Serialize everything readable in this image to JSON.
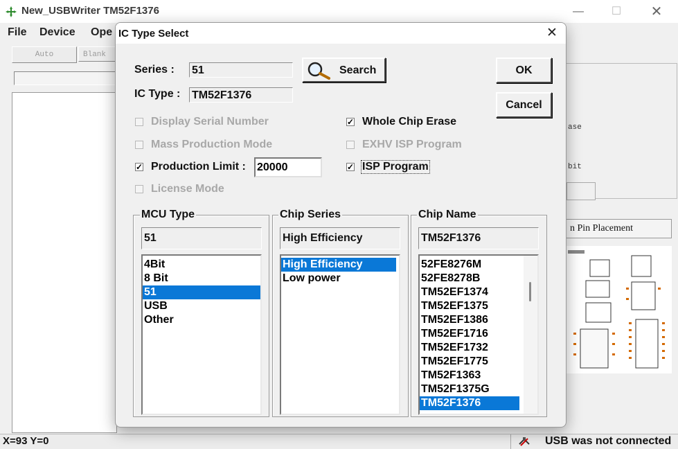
{
  "main": {
    "title": "New_USBWriter  TM52F1376",
    "menu": [
      "File",
      "Device",
      "Ope"
    ],
    "toolbar": {
      "auto": "Auto",
      "blank": "Blank"
    },
    "right_panel": {
      "erase_fragment": "ase",
      "bit_fragment": "bit",
      "pin_placement": "n Pin Placement"
    },
    "status": {
      "coords": "X=93 Y=0",
      "usb": "USB was not connected"
    }
  },
  "dialog": {
    "title": "IC Type Select",
    "series_label": "Series :",
    "series_value": "51",
    "ictype_label": "IC Type :",
    "ictype_value": "TM52F1376",
    "search_label": "Search",
    "ok_label": "OK",
    "cancel_label": "Cancel",
    "options": {
      "display_serial": {
        "label": "Display Serial Number",
        "checked": false,
        "enabled": false
      },
      "mass_production": {
        "label": "Mass Production Mode",
        "checked": false,
        "enabled": false
      },
      "production_limit": {
        "label": "Production Limit :",
        "checked": true,
        "enabled": true,
        "value": "20000"
      },
      "license_mode": {
        "label": "License Mode",
        "checked": false,
        "enabled": false
      },
      "whole_chip_erase": {
        "label": "Whole Chip Erase",
        "checked": true,
        "enabled": true
      },
      "exhv_isp": {
        "label": "EXHV ISP Program",
        "checked": false,
        "enabled": false
      },
      "isp_program": {
        "label": "ISP Program",
        "checked": true,
        "enabled": true
      }
    },
    "mcu_type": {
      "title": "MCU Type",
      "selected": "51",
      "items": [
        {
          "label": "4Bit",
          "selected": false
        },
        {
          "label": "8 Bit",
          "selected": false
        },
        {
          "label": "51",
          "selected": true
        },
        {
          "label": "USB",
          "selected": false
        },
        {
          "label": "Other",
          "selected": false
        }
      ]
    },
    "chip_series": {
      "title": "Chip Series",
      "selected": "High Efficiency",
      "items": [
        {
          "label": "High Efficiency",
          "selected": true
        },
        {
          "label": "Low power",
          "selected": false
        }
      ]
    },
    "chip_name": {
      "title": "Chip Name",
      "selected": "TM52F1376",
      "items": [
        {
          "label": "52FE8276M",
          "selected": false
        },
        {
          "label": "52FE8278B",
          "selected": false
        },
        {
          "label": "TM52EF1374",
          "selected": false
        },
        {
          "label": "TM52EF1375",
          "selected": false
        },
        {
          "label": "TM52EF1386",
          "selected": false
        },
        {
          "label": "TM52EF1716",
          "selected": false
        },
        {
          "label": "TM52EF1732",
          "selected": false
        },
        {
          "label": "TM52EF1775",
          "selected": false
        },
        {
          "label": "TM52F1363",
          "selected": false
        },
        {
          "label": "TM52F1375G",
          "selected": false
        },
        {
          "label": "TM52F1376",
          "selected": true
        }
      ]
    }
  },
  "colors": {
    "selection": "#0a78d7",
    "disabled_text": "#a8a8a8",
    "window_bg": "#f0f0f0"
  },
  "icons": [
    "app-icon",
    "magnifier-icon",
    "close-icon",
    "usb-icon"
  ]
}
